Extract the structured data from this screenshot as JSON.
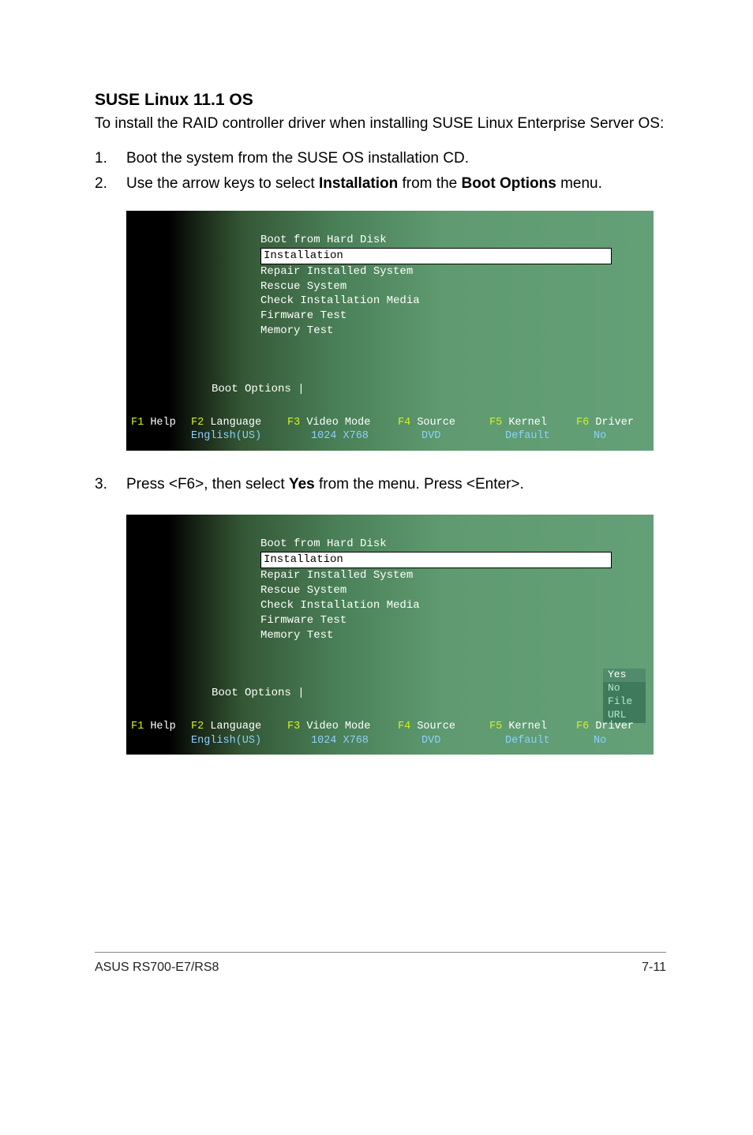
{
  "heading": "SUSE Linux 11.1 OS",
  "intro": "To install the RAID controller driver when installing SUSE Linux Enterprise Server OS:",
  "steps_a": [
    {
      "num": "1.",
      "text": "Boot the system from the SUSE OS installation CD."
    },
    {
      "num": "2.",
      "text_pre": "Use the arrow keys to select ",
      "b1": "Installation",
      "mid": " from the ",
      "b2": "Boot Options",
      "text_post": " menu."
    }
  ],
  "steps_b": [
    {
      "num": "3.",
      "text_pre": "Press <F6>, then select ",
      "b1": "Yes",
      "text_post": " from the menu. Press <Enter>."
    }
  ],
  "boot": {
    "menu": [
      "Boot from Hard Disk",
      "Installation",
      "Repair Installed System",
      "Rescue System",
      "Check Installation Media",
      "Firmware Test",
      "Memory Test"
    ],
    "boot_options_label": "Boot Options |",
    "fkeys": {
      "f1": {
        "key": "F1",
        "label": "Help",
        "sub": ""
      },
      "f2": {
        "key": "F2",
        "label": "Language",
        "sub": "English(US)"
      },
      "f3": {
        "key": "F3",
        "label": "Video Mode",
        "sub": "1024 X768"
      },
      "f4": {
        "key": "F4",
        "label": "Source",
        "sub": "DVD"
      },
      "f5": {
        "key": "F5",
        "label": "Kernel",
        "sub": "Default"
      },
      "f6": {
        "key": "F6",
        "label": "Driver",
        "sub": "No"
      }
    },
    "f6_popup": [
      "Yes",
      "No",
      "File",
      "URL"
    ]
  },
  "footer": {
    "left": "ASUS RS700-E7/RS8",
    "right": "7-11"
  }
}
